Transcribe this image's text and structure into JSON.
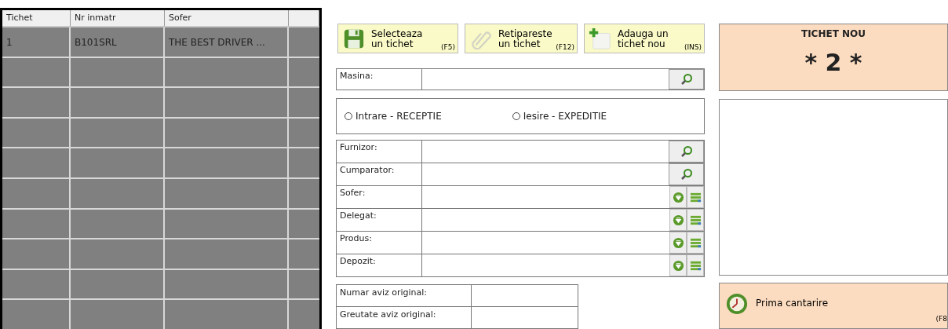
{
  "grid": {
    "columns": [
      "Tichet",
      "Nr inmatr",
      "Sofer"
    ],
    "rows": [
      {
        "cells": [
          "1",
          "B101SRL",
          "THE BEST DRIVER ..."
        ]
      }
    ]
  },
  "actions": [
    {
      "label": "Selecteaza un tichet",
      "key": "(F5)",
      "kind": "select"
    },
    {
      "label": "Retipareste un tichet",
      "key": "(F12)",
      "kind": "reprint"
    },
    {
      "label": "Adauga un tichet nou",
      "key": "(INS)",
      "kind": "add"
    }
  ],
  "vehicle": {
    "label": "Masina:"
  },
  "direction": [
    {
      "label": "Intrare - RECEPTIE",
      "selected": false
    },
    {
      "label": "Iesire - EXPEDITIE",
      "selected": false
    }
  ],
  "fields": [
    {
      "label": "Furnizor:",
      "kind": "search"
    },
    {
      "label": "Cumparator:",
      "kind": "search"
    },
    {
      "label": "Sofer:",
      "kind": "pick"
    },
    {
      "label": "Delegat:",
      "kind": "pick"
    },
    {
      "label": "Produs:",
      "kind": "pick"
    },
    {
      "label": "Depozit:",
      "kind": "pick"
    }
  ],
  "aviz": [
    {
      "label": "Numar aviz original:"
    },
    {
      "label": "Greutate aviz original:"
    }
  ],
  "ticket": {
    "title": "TICHET NOU",
    "number": "* 2 *"
  },
  "weigh": {
    "label": "Prima cantarire",
    "key": "(F8"
  }
}
